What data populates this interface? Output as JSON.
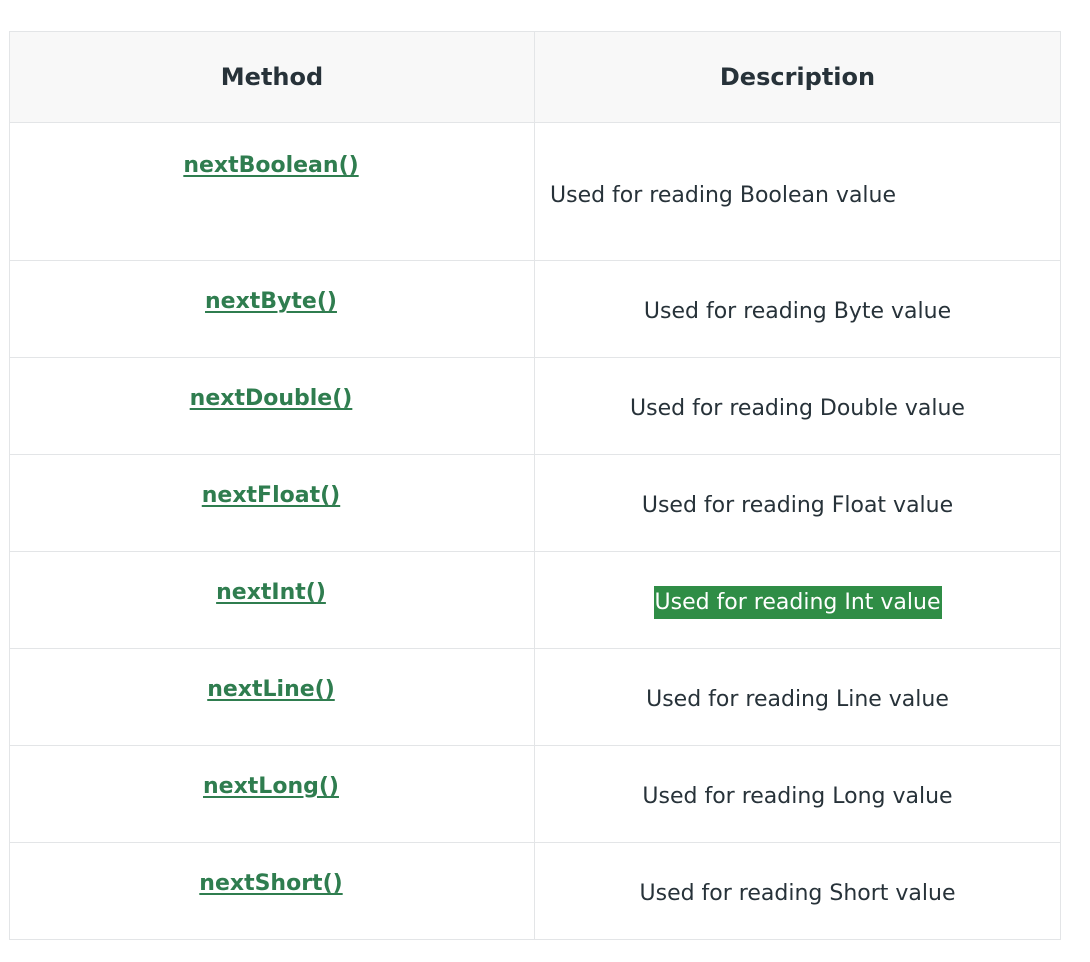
{
  "table": {
    "headers": {
      "method": "Method",
      "description": "Description"
    },
    "rows": [
      {
        "method": "nextBoolean()",
        "description": "Used for reading Boolean value",
        "highlighted": false
      },
      {
        "method": "nextByte()",
        "description": "Used for reading Byte value",
        "highlighted": false
      },
      {
        "method": "nextDouble()",
        "description": "Used for reading Double value",
        "highlighted": false
      },
      {
        "method": "nextFloat()",
        "description": "Used for reading Float value",
        "highlighted": false
      },
      {
        "method": "nextInt()",
        "description": "Used for reading Int value",
        "highlighted": true
      },
      {
        "method": "nextLine()",
        "description": "Used for reading Line value",
        "highlighted": false
      },
      {
        "method": "nextLong()",
        "description": "Used for reading Long value",
        "highlighted": false
      },
      {
        "method": "nextShort()",
        "description": "Used for reading Short value",
        "highlighted": false
      }
    ]
  },
  "colors": {
    "link": "#2f7d4f",
    "highlight_bg": "#2f8d46",
    "header_bg": "#f8f8f8",
    "border": "#e3e5e7",
    "text": "#273239"
  }
}
